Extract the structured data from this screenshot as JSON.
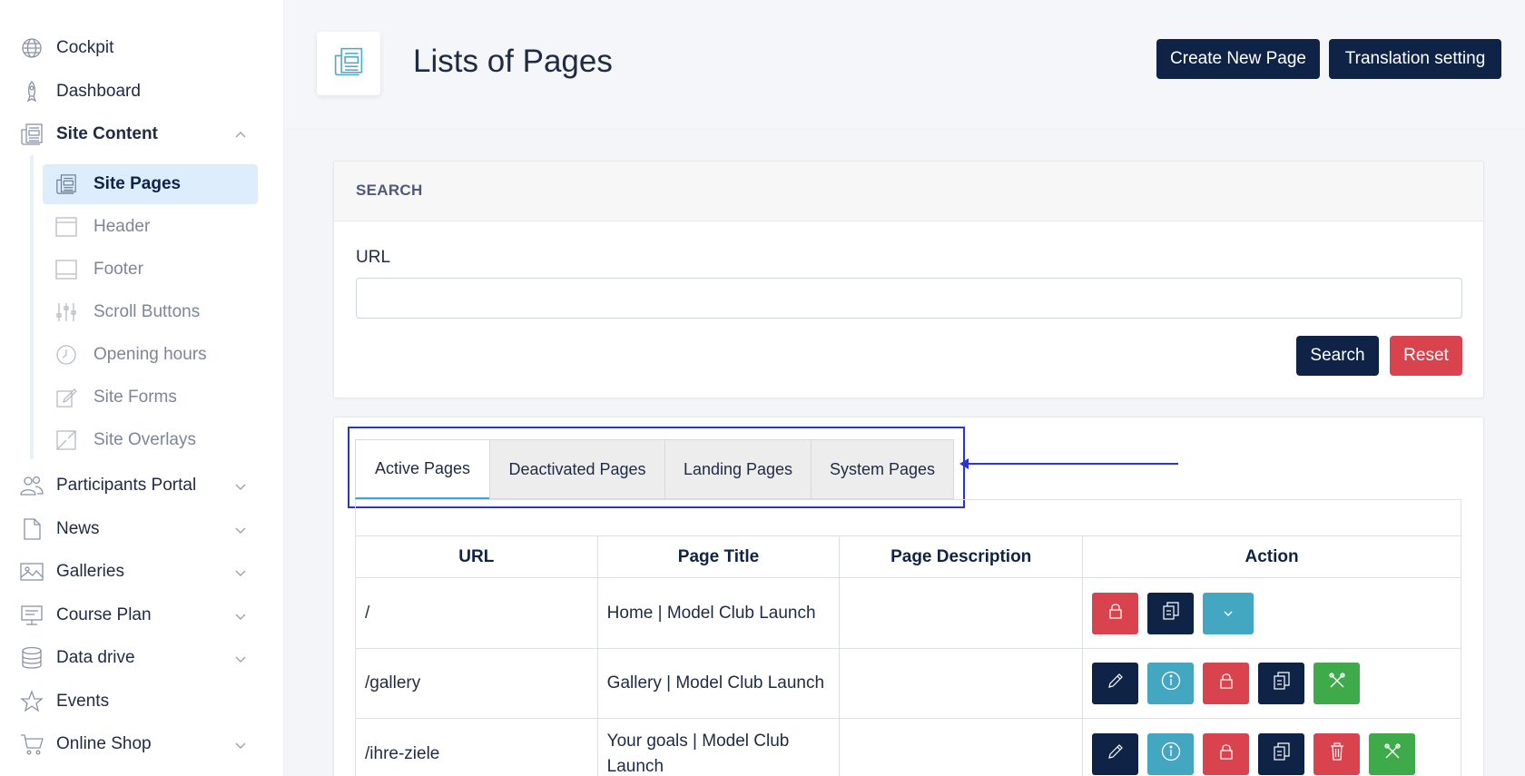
{
  "sidebar": {
    "items": [
      {
        "label": "Cockpit",
        "icon": "globe-icon"
      },
      {
        "label": "Dashboard",
        "icon": "rocket-icon"
      },
      {
        "label": "Site Content",
        "icon": "newspaper-icon",
        "expanded": true
      },
      {
        "label": "Participants Portal",
        "icon": "users-icon"
      },
      {
        "label": "News",
        "icon": "document-icon"
      },
      {
        "label": "Galleries",
        "icon": "image-icon"
      },
      {
        "label": "Course Plan",
        "icon": "presentation-icon"
      },
      {
        "label": "Data drive",
        "icon": "database-icon"
      },
      {
        "label": "Events",
        "icon": "star-icon"
      },
      {
        "label": "Online Shop",
        "icon": "cart-icon"
      }
    ],
    "sub_items": [
      {
        "label": "Site Pages",
        "icon": "newspaper-icon",
        "active": true
      },
      {
        "label": "Header",
        "icon": "header-layout-icon"
      },
      {
        "label": "Footer",
        "icon": "footer-layout-icon"
      },
      {
        "label": "Scroll Buttons",
        "icon": "sliders-icon"
      },
      {
        "label": "Opening hours",
        "icon": "clock-icon"
      },
      {
        "label": "Site Forms",
        "icon": "edit-icon"
      },
      {
        "label": "Site Overlays",
        "icon": "overlay-icon"
      }
    ]
  },
  "header": {
    "title": "Lists of Pages",
    "create_label": "Create New Page",
    "translation_label": "Translation setting"
  },
  "search": {
    "heading": "SEARCH",
    "url_label": "URL",
    "url_value": "",
    "search_label": "Search",
    "reset_label": "Reset"
  },
  "tabs": [
    {
      "label": "Active Pages",
      "active": true
    },
    {
      "label": "Deactivated Pages"
    },
    {
      "label": "Landing Pages"
    },
    {
      "label": "System Pages"
    }
  ],
  "table": {
    "columns": [
      "URL",
      "Page Title",
      "Page Description",
      "Action"
    ],
    "rows": [
      {
        "url": "/",
        "title": "Home | Model Club Launch",
        "description": "",
        "actions": [
          "lock-icon",
          "copy-icon",
          "chevron-down-icon"
        ]
      },
      {
        "url": "/gallery",
        "title": "Gallery | Model Club Launch",
        "description": "",
        "actions": [
          "pencil-icon",
          "info-icon",
          "lock-icon",
          "copy-icon",
          "tools-icon"
        ]
      },
      {
        "url": "/ihre-ziele",
        "title": "Your goals | Model Club Launch",
        "description": "",
        "actions": [
          "pencil-icon",
          "info-icon",
          "lock-icon",
          "copy-icon",
          "trash-icon",
          "tools-icon"
        ]
      }
    ]
  },
  "colors": {
    "navy": "#0f2347",
    "red": "#d9434e",
    "teal": "#44a7c1",
    "green": "#3eaa4a",
    "annotation": "#2a33d6"
  }
}
